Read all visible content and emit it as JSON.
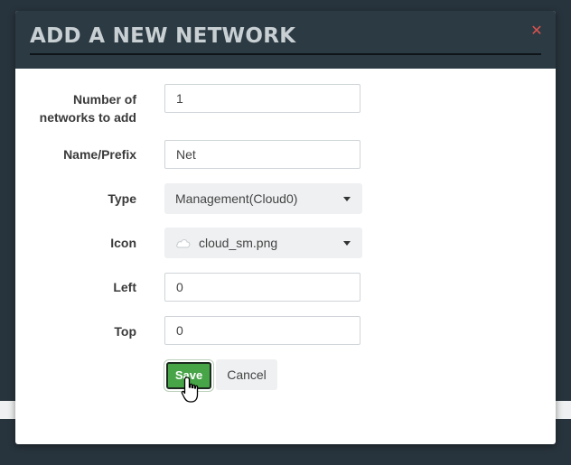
{
  "modal": {
    "title": "ADD A NEW NETWORK",
    "close_icon": "close-icon",
    "accent_color": "#47a447",
    "close_color": "#d9534f"
  },
  "form": {
    "count_label_line1": "Number of",
    "count_label_line2": "networks to add",
    "count_value": "1",
    "name_label": "Name/Prefix",
    "name_value": "Net",
    "type_label": "Type",
    "type_value": "Management(Cloud0)",
    "icon_label": "Icon",
    "icon_value": "cloud_sm.png",
    "icon_glyph": "cloud-icon",
    "left_label": "Left",
    "left_value": "0",
    "top_label": "Top",
    "top_value": "0"
  },
  "actions": {
    "save_label": "Save",
    "cancel_label": "Cancel"
  }
}
